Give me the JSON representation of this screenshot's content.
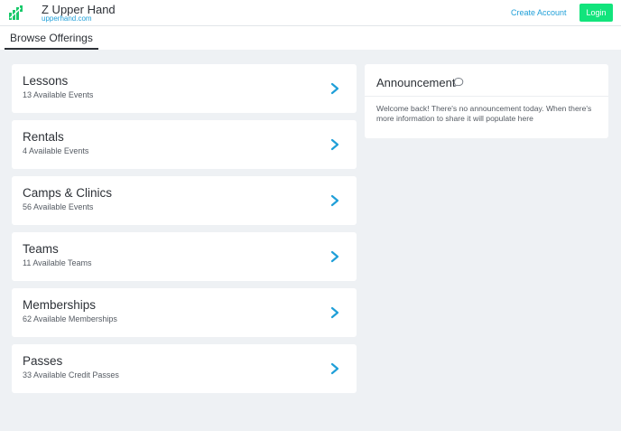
{
  "header": {
    "brand_name": "Z Upper Hand",
    "brand_url": "upperhand.com",
    "create_account_label": "Create Account",
    "login_label": "Login"
  },
  "nav": {
    "tab_label": "Browse Offerings"
  },
  "offerings": [
    {
      "title": "Lessons",
      "subtitle": "13 Available Events"
    },
    {
      "title": "Rentals",
      "subtitle": "4 Available Events"
    },
    {
      "title": "Camps & Clinics",
      "subtitle": "56 Available Events"
    },
    {
      "title": "Teams",
      "subtitle": "11 Available Teams"
    },
    {
      "title": "Memberships",
      "subtitle": "62 Available Memberships"
    },
    {
      "title": "Passes",
      "subtitle": "33 Available Credit Passes"
    }
  ],
  "announcement": {
    "title": "Announcement",
    "icon": "speech-bubble-icon",
    "body": "Welcome back! There's no announcement today. When there's more information to share it will populate here"
  },
  "colors": {
    "accent": "#1f9fd8",
    "login_bg": "#12e47c",
    "logo_green": "#18c96a",
    "page_bg": "#eef1f4"
  }
}
